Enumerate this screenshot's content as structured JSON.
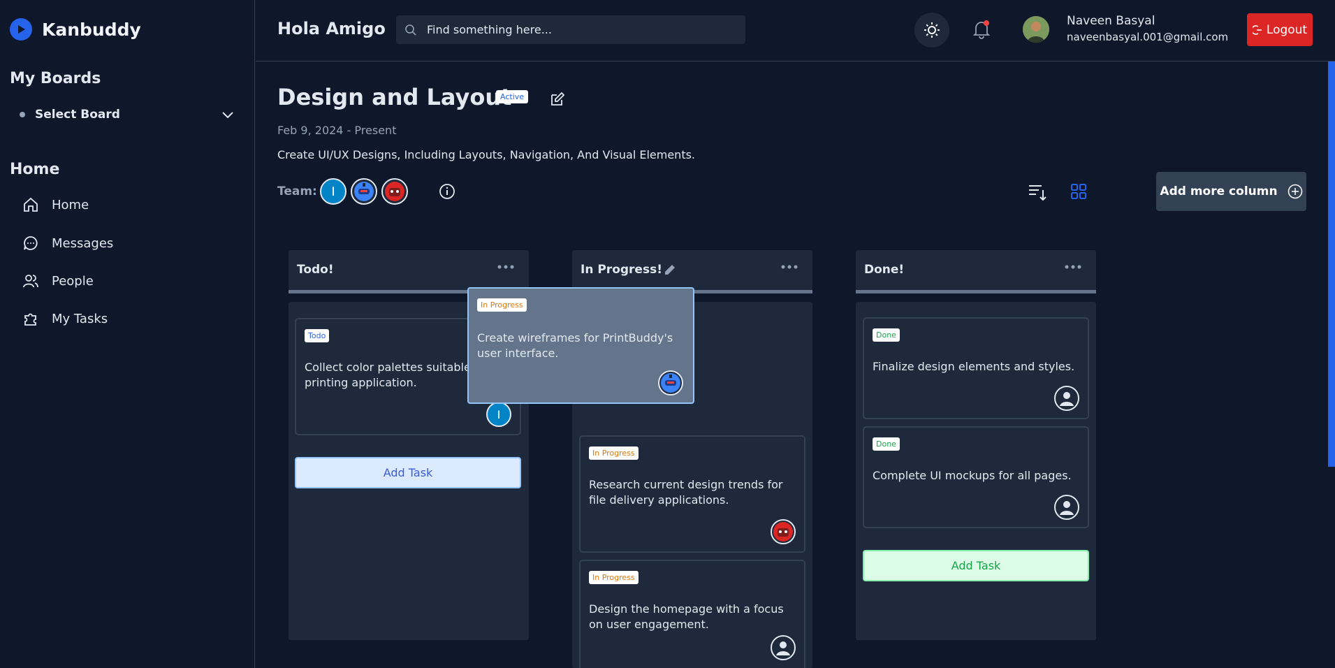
{
  "app": {
    "name": "Kanbuddy"
  },
  "sidebar": {
    "boards_title": "My Boards",
    "select_board_label": "Select Board",
    "home_title": "Home",
    "items": [
      {
        "label": "Home",
        "icon": "home-icon"
      },
      {
        "label": "Messages",
        "icon": "chat-icon"
      },
      {
        "label": "People",
        "icon": "people-icon"
      },
      {
        "label": "My Tasks",
        "icon": "puzzle-icon"
      }
    ]
  },
  "header": {
    "greeting": "Hola Amigo",
    "search_placeholder": "Find something here...",
    "user_name": "Naveen Basyal",
    "user_email": "naveenbasyal.001@gmail.com",
    "logout_label": "Logout"
  },
  "board": {
    "title": "Design and Layout",
    "status": "Active",
    "date": "Feb 9, 2024 - Present",
    "description": "Create UI/UX Designs, Including Layouts, Navigation, And Visual Elements.",
    "team_label": "Team:",
    "team_initial": "I",
    "add_column_label": "Add more column"
  },
  "columns": [
    {
      "title": "Todo!",
      "cards": [
        {
          "tag": "Todo",
          "text": "Collect color palettes suitable for a printing application.",
          "avatar": "I"
        }
      ],
      "add_task": "Add Task"
    },
    {
      "title": "In Progress!",
      "cards": [
        {
          "tag": "In Progress",
          "text": "Research current design trends for file delivery applications."
        },
        {
          "tag": "In Progress",
          "text": "Design the homepage with a focus on user engagement."
        }
      ]
    },
    {
      "title": "Done!",
      "cards": [
        {
          "tag": "Done",
          "text": "Finalize design elements and styles."
        },
        {
          "tag": "Done",
          "text": "Complete UI mockups for all pages."
        }
      ],
      "add_task": "Add Task"
    }
  ],
  "dragging_card": {
    "tag": "In Progress",
    "text": "Create wireframes for PrintBuddy's user interface."
  },
  "colors": {
    "accent": "#2563eb",
    "logout": "#dc2626",
    "background": "#0f172a",
    "panel": "#1e293b"
  }
}
